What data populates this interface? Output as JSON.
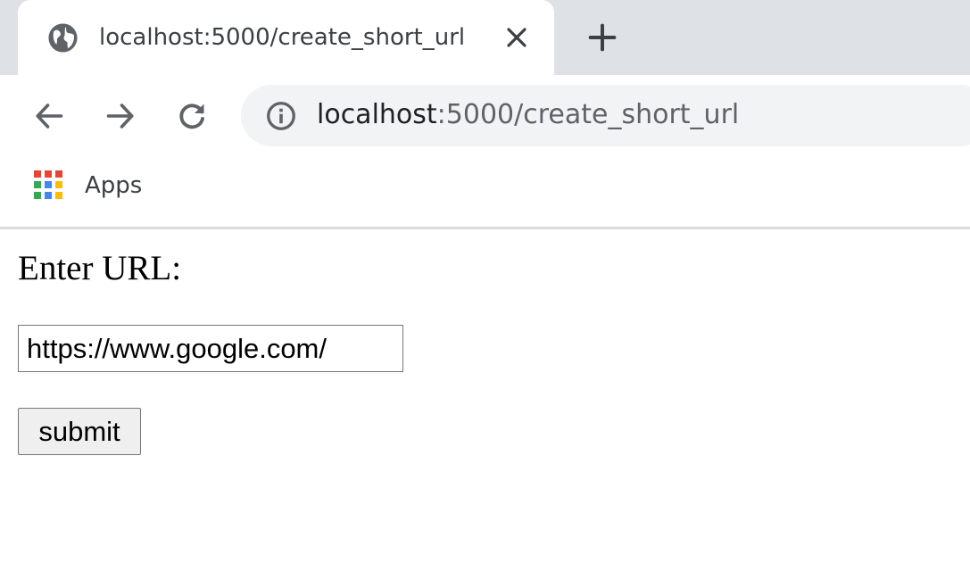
{
  "browser": {
    "tab": {
      "title": "localhost:5000/create_short_url",
      "favicon": "globe-icon",
      "close_icon": "close-icon"
    },
    "new_tab_icon": "plus-icon",
    "nav": {
      "back_icon": "arrow-left-icon",
      "forward_icon": "arrow-right-icon",
      "reload_icon": "reload-icon"
    },
    "omnibox": {
      "security_icon": "info-icon",
      "host": "localhost",
      "rest": ":5000/create_short_url"
    },
    "bookmarks": {
      "apps_label": "Apps",
      "apps_icon": "apps-grid-icon"
    }
  },
  "page": {
    "label": "Enter URL:",
    "url_input_value": "https://www.google.com/",
    "submit_label": "submit"
  },
  "colors": {
    "tabstrip_bg": "#dee1e6",
    "omnibox_bg": "#f1f3f4",
    "icon_gray": "#5f6368",
    "button_bg": "#efefef"
  }
}
